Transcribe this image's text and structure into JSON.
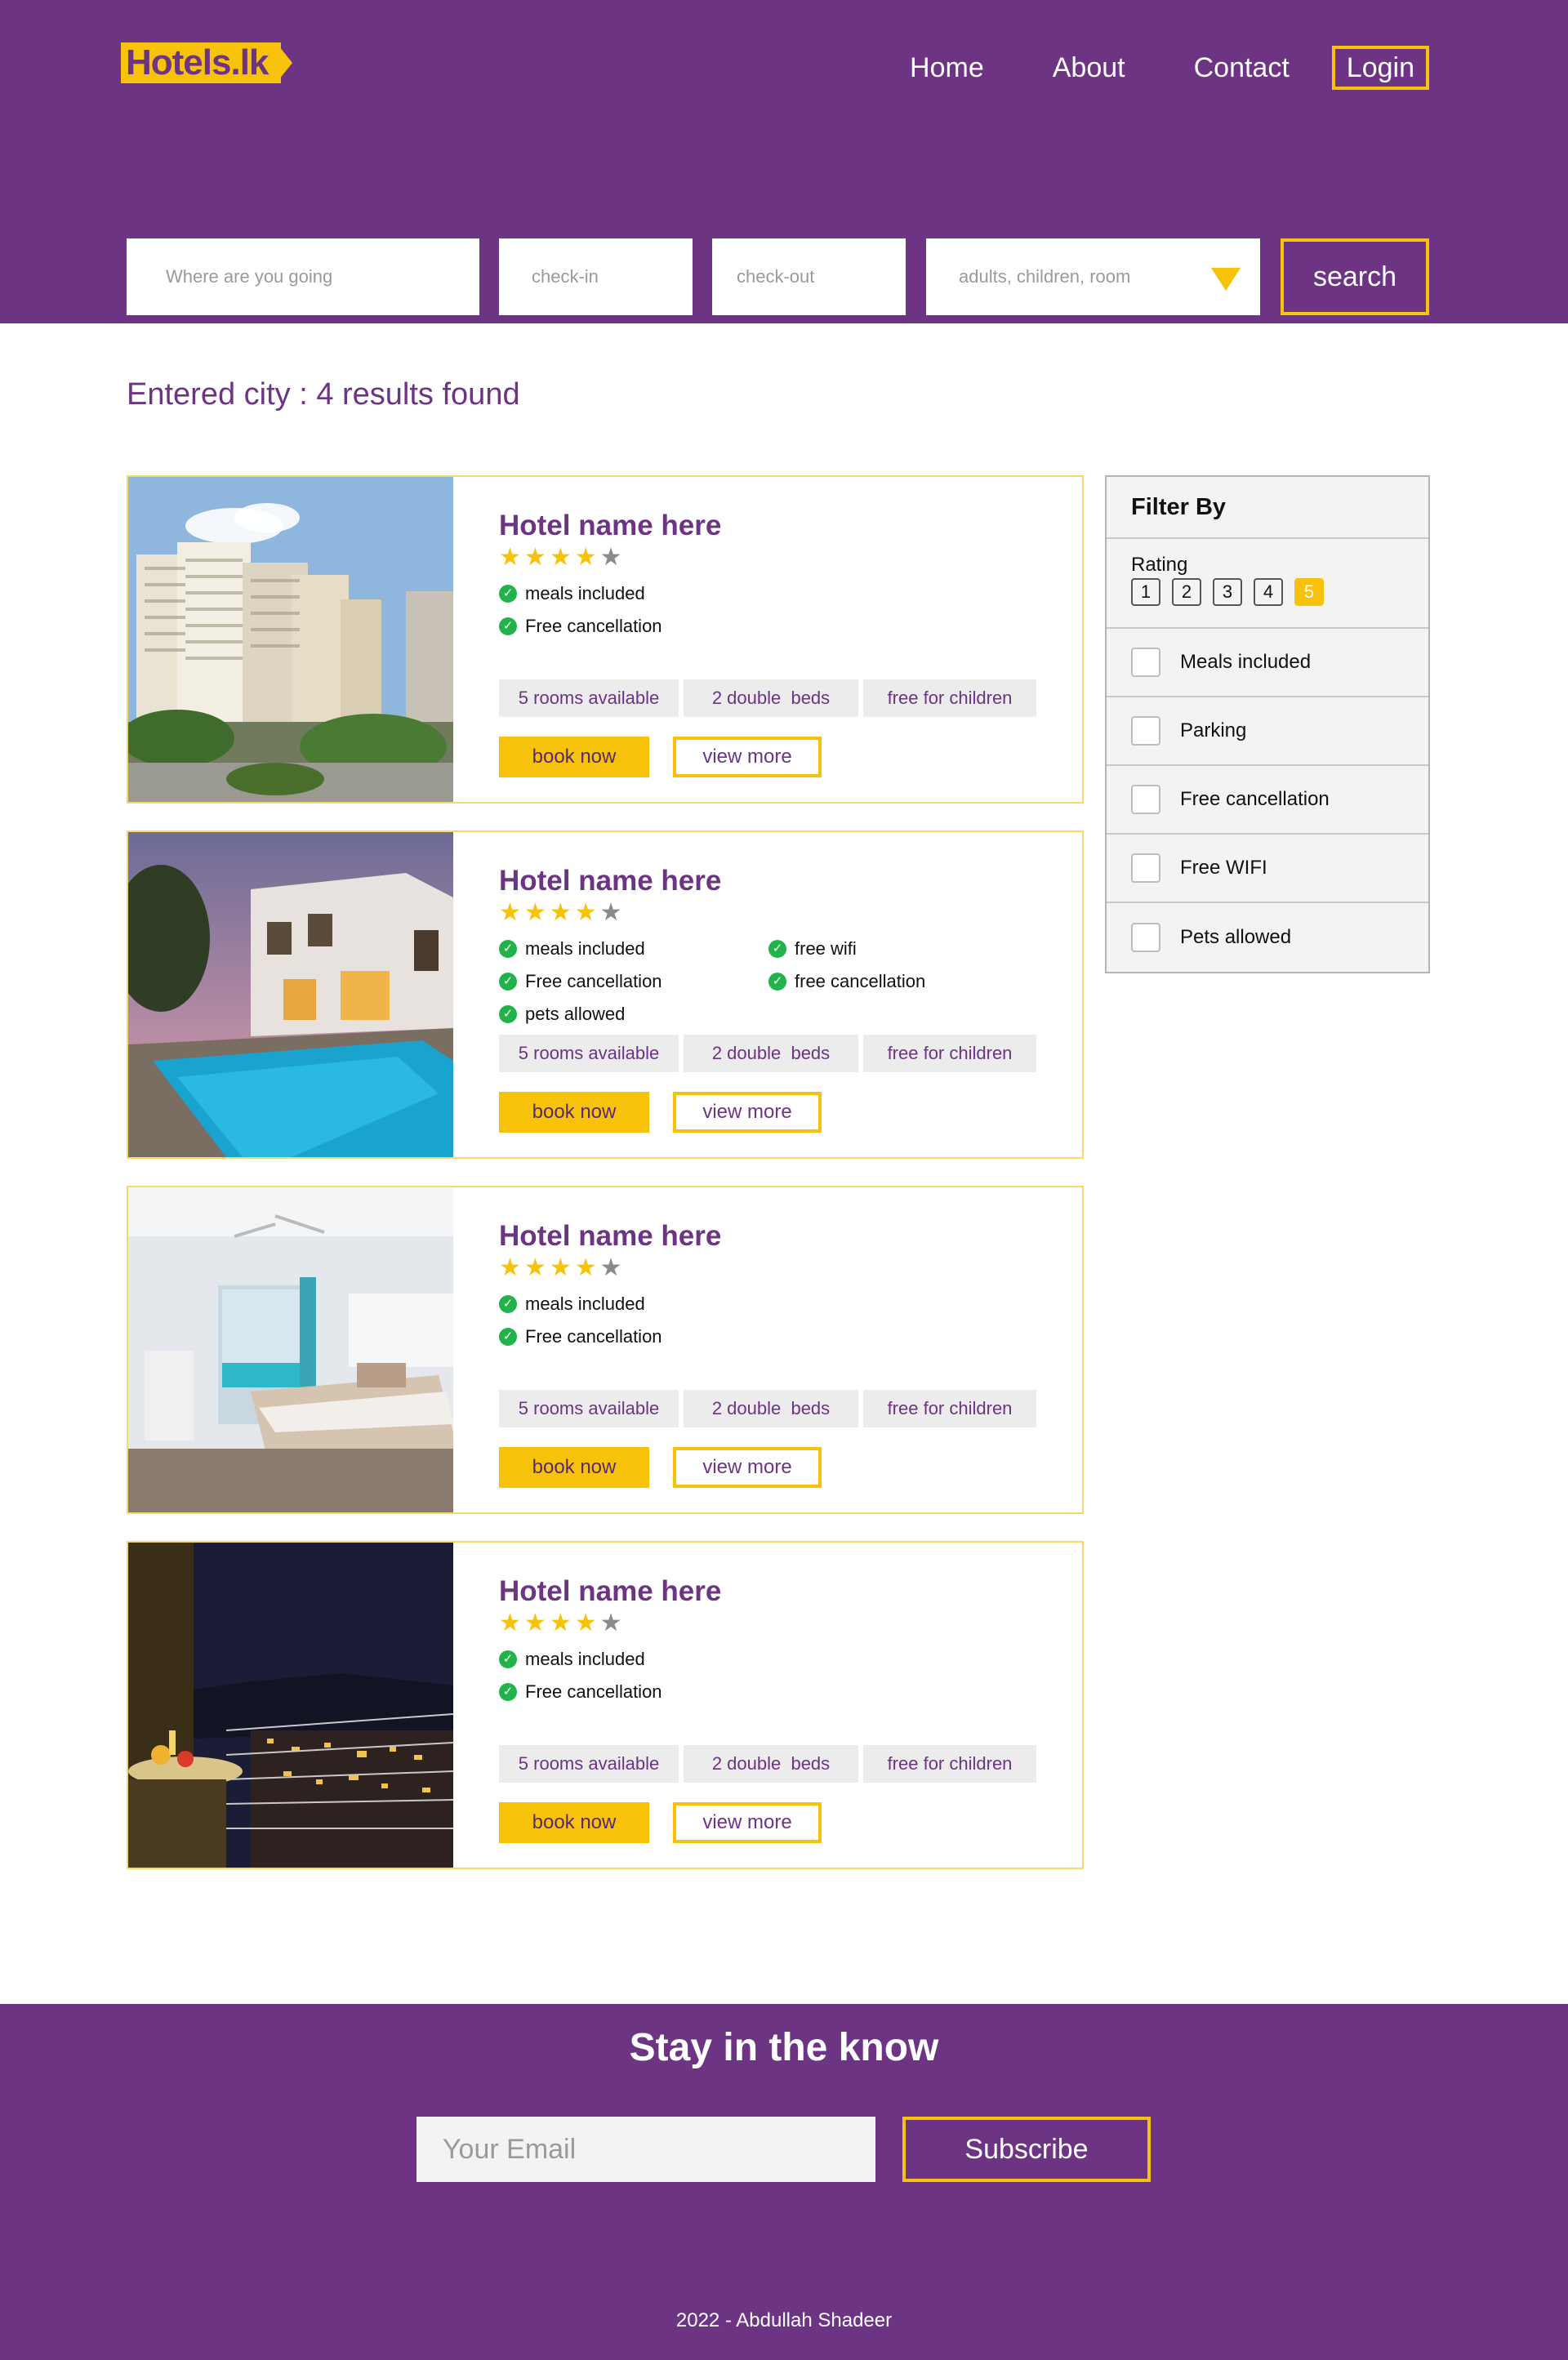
{
  "brand": {
    "logo_text": "Hotels.lk",
    "primary": "#6c3483",
    "accent": "#f7c30a"
  },
  "nav": {
    "home": "Home",
    "about": "About",
    "contact": "Contact",
    "login": "Login"
  },
  "search": {
    "destination_placeholder": "Where are you going",
    "checkin_placeholder": "check-in",
    "checkout_placeholder": "check-out",
    "guests_placeholder": "adults, children, room",
    "button": "search"
  },
  "results": {
    "title": "Entered city : 4 results found"
  },
  "hotels": [
    {
      "name": "Hotel name here",
      "rating": 4,
      "max_rating": 5,
      "image": "city-tower-hotel",
      "features": [
        "meals included",
        "Free cancellation"
      ],
      "tags": [
        "5 rooms available",
        "2 double  beds",
        "free for children"
      ],
      "book": "book now",
      "view": "view more"
    },
    {
      "name": "Hotel name here",
      "rating": 4,
      "max_rating": 5,
      "image": "villa-with-pool",
      "features": [
        "meals included",
        "Free cancellation",
        "pets allowed",
        "free wifi",
        "free cancellation"
      ],
      "tags": [
        "5 rooms available",
        "2 double  beds",
        "free for children"
      ],
      "book": "book now",
      "view": "view more"
    },
    {
      "name": "Hotel name here",
      "rating": 4,
      "max_rating": 5,
      "image": "bedroom-with-pool-view",
      "features": [
        "meals included",
        "Free cancellation"
      ],
      "tags": [
        "5 rooms available",
        "2 double  beds",
        "free for children"
      ],
      "book": "book now",
      "view": "view more"
    },
    {
      "name": "Hotel name here",
      "rating": 4,
      "max_rating": 5,
      "image": "night-balcony-view",
      "features": [
        "meals included",
        "Free cancellation"
      ],
      "tags": [
        "5 rooms available",
        "2 double  beds",
        "free for children"
      ],
      "book": "book now",
      "view": "view more"
    }
  ],
  "filter": {
    "title": "Filter By",
    "rating_label": "Rating",
    "ratings": [
      "1",
      "2",
      "3",
      "4",
      "5"
    ],
    "selected_rating": "5",
    "options": [
      "Meals included",
      "Parking",
      "Free cancellation",
      "Free WIFI",
      "Pets allowed"
    ]
  },
  "footer": {
    "title": "Stay in the know",
    "email_placeholder": "Your Email",
    "subscribe": "Subscribe",
    "copyright": "2022 - Abdullah Shadeer"
  }
}
